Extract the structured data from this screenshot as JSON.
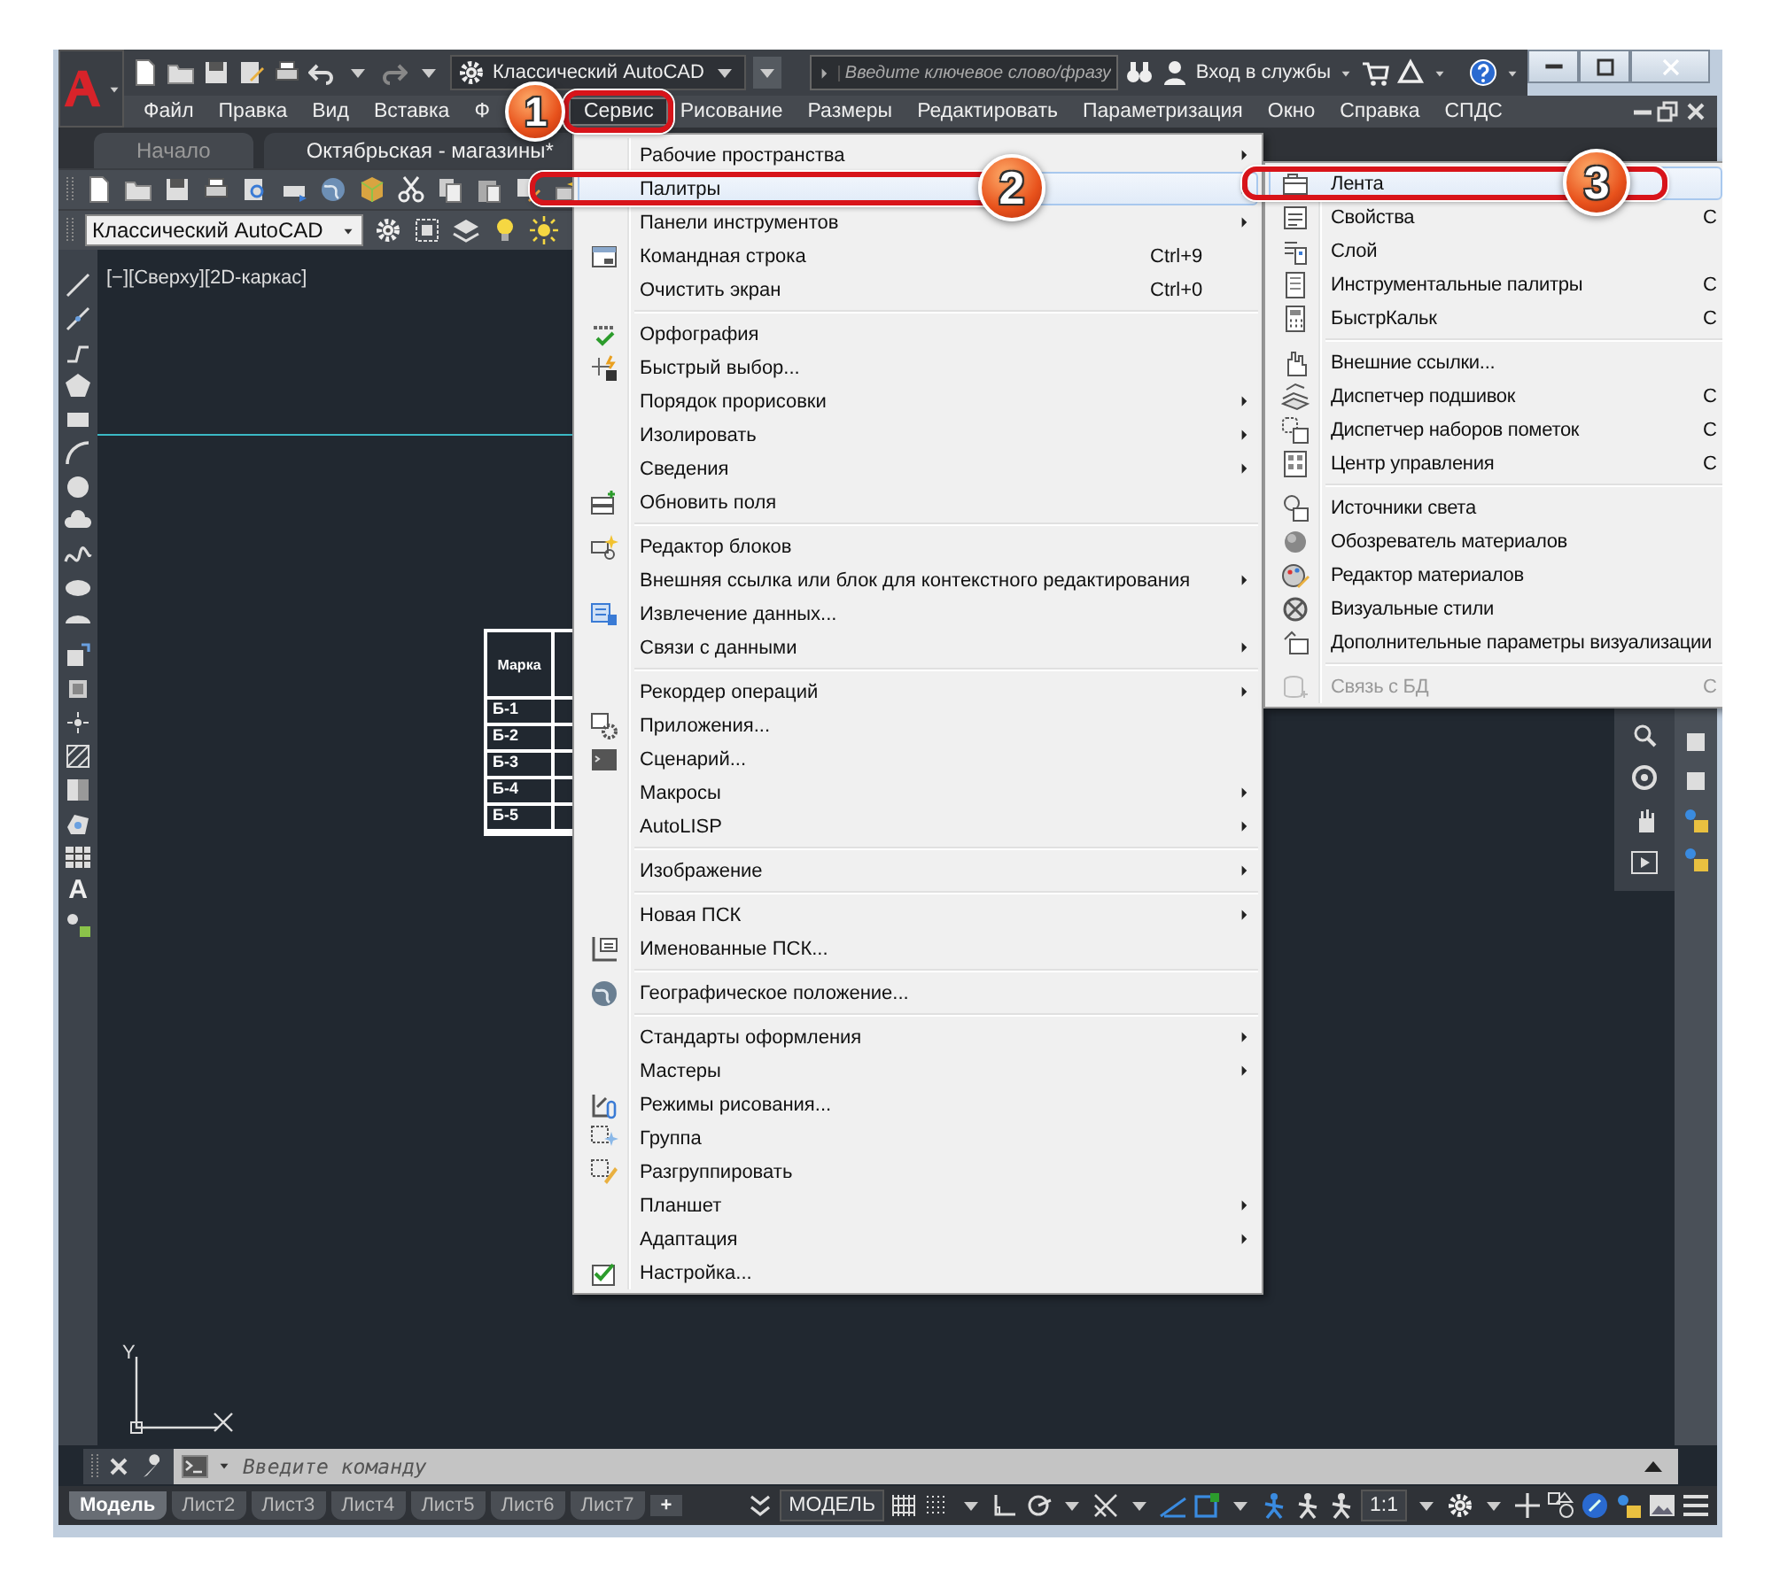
{
  "title_bar": {
    "workspace": "Классический AutoCAD",
    "search_placeholder": "Введите ключевое слово/фразу",
    "sign_in": "Вход в службы"
  },
  "menu_bar": [
    {
      "label": "Файл",
      "selected": false
    },
    {
      "label": "Правка",
      "selected": false
    },
    {
      "label": "Вид",
      "selected": false
    },
    {
      "label": "Вставка",
      "selected": false
    },
    {
      "label": "Ф",
      "selected": false
    },
    {
      "label": "Сервис",
      "selected": true
    },
    {
      "label": "Рисование",
      "selected": false
    },
    {
      "label": "Размеры",
      "selected": false
    },
    {
      "label": "Редактировать",
      "selected": false
    },
    {
      "label": "Параметризация",
      "selected": false
    },
    {
      "label": "Окно",
      "selected": false
    },
    {
      "label": "Справка",
      "selected": false
    },
    {
      "label": "СПДС",
      "selected": false
    }
  ],
  "doc_tabs": [
    {
      "label": "Начало",
      "selected": false
    },
    {
      "label": "Октябрьская - магазины*",
      "selected": true
    }
  ],
  "workspace_dropdown": "Классический AutoCAD",
  "viewport_label": "[−][Сверху][2D-каркас]",
  "text_tool_label": "A",
  "drawing_table": {
    "header": "Марка",
    "rows": [
      "Б-1",
      "Б-2",
      "Б-3",
      "Б-4",
      "Б-5"
    ]
  },
  "ucs_axis_label": "Y",
  "service_menu": [
    {
      "kind": "item",
      "label": "Рабочие пространства",
      "submenu": true,
      "selected": false
    },
    {
      "kind": "item",
      "label": "Палитры",
      "submenu": true,
      "selected": true
    },
    {
      "kind": "item",
      "label": "Панели инструментов",
      "submenu": true,
      "selected": false
    },
    {
      "kind": "item",
      "label": "Командная строка",
      "shortcut": "Ctrl+9",
      "icon": true,
      "selected": false
    },
    {
      "kind": "item",
      "label": "Очистить экран",
      "shortcut": "Ctrl+0",
      "selected": false
    },
    {
      "kind": "separator"
    },
    {
      "kind": "item",
      "label": "Орфография",
      "icon": true,
      "selected": false
    },
    {
      "kind": "item",
      "label": "Быстрый выбор...",
      "icon": true,
      "selected": false
    },
    {
      "kind": "item",
      "label": "Порядок прорисовки",
      "submenu": true,
      "selected": false
    },
    {
      "kind": "item",
      "label": "Изолировать",
      "submenu": true,
      "selected": false
    },
    {
      "kind": "item",
      "label": "Сведения",
      "submenu": true,
      "selected": false
    },
    {
      "kind": "item",
      "label": "Обновить поля",
      "icon": true,
      "selected": false
    },
    {
      "kind": "separator"
    },
    {
      "kind": "item",
      "label": "Редактор блоков",
      "icon": true,
      "selected": false
    },
    {
      "kind": "item",
      "label": "Внешняя ссылка или блок для контекстного редактирования",
      "submenu": true,
      "selected": false
    },
    {
      "kind": "item",
      "label": "Извлечение данных...",
      "icon": true,
      "selected": false
    },
    {
      "kind": "item",
      "label": "Связи с данными",
      "submenu": true,
      "selected": false
    },
    {
      "kind": "separator"
    },
    {
      "kind": "item",
      "label": "Рекордер операций",
      "submenu": true,
      "selected": false
    },
    {
      "kind": "item",
      "label": "Приложения...",
      "icon": true,
      "selected": false
    },
    {
      "kind": "item",
      "label": "Сценарий...",
      "icon": true,
      "selected": false
    },
    {
      "kind": "item",
      "label": "Макросы",
      "submenu": true,
      "selected": false
    },
    {
      "kind": "item",
      "label": "AutoLISP",
      "submenu": true,
      "selected": false
    },
    {
      "kind": "separator"
    },
    {
      "kind": "item",
      "label": "Изображение",
      "submenu": true,
      "selected": false
    },
    {
      "kind": "separator"
    },
    {
      "kind": "item",
      "label": "Новая ПСК",
      "submenu": true,
      "selected": false
    },
    {
      "kind": "item",
      "label": "Именованные ПСК...",
      "icon": true,
      "selected": false
    },
    {
      "kind": "separator"
    },
    {
      "kind": "item",
      "label": "Географическое положение...",
      "icon": true,
      "selected": false
    },
    {
      "kind": "separator"
    },
    {
      "kind": "item",
      "label": "Стандарты оформления",
      "submenu": true,
      "selected": false
    },
    {
      "kind": "item",
      "label": "Мастеры",
      "submenu": true,
      "selected": false
    },
    {
      "kind": "item",
      "label": "Режимы рисования...",
      "icon": true,
      "selected": false
    },
    {
      "kind": "item",
      "label": "Группа",
      "icon": true,
      "selected": false
    },
    {
      "kind": "item",
      "label": "Разгруппировать",
      "icon": true,
      "selected": false
    },
    {
      "kind": "item",
      "label": "Планшет",
      "submenu": true,
      "selected": false
    },
    {
      "kind": "item",
      "label": "Адаптация",
      "submenu": true,
      "selected": false
    },
    {
      "kind": "item",
      "label": "Настройка...",
      "icon": true,
      "selected": false
    }
  ],
  "palettes_submenu": [
    {
      "kind": "item",
      "label": "Лента",
      "selected": true,
      "disabled": false
    },
    {
      "kind": "item",
      "label": "Свойства",
      "shortcut": "C",
      "selected": false,
      "disabled": false
    },
    {
      "kind": "item",
      "label": "Слой",
      "selected": false,
      "disabled": false
    },
    {
      "kind": "item",
      "label": "Инструментальные палитры",
      "shortcut": "C",
      "selected": false,
      "disabled": false
    },
    {
      "kind": "item",
      "label": "БыстрКальк",
      "shortcut": "C",
      "selected": false,
      "disabled": false
    },
    {
      "kind": "separator"
    },
    {
      "kind": "item",
      "label": "Внешние ссылки...",
      "selected": false,
      "disabled": false
    },
    {
      "kind": "item",
      "label": "Диспетчер подшивок",
      "shortcut": "C",
      "selected": false,
      "disabled": false
    },
    {
      "kind": "item",
      "label": "Диспетчер наборов пометок",
      "shortcut": "C",
      "selected": false,
      "disabled": false
    },
    {
      "kind": "item",
      "label": "Центр управления",
      "shortcut": "C",
      "selected": false,
      "disabled": false
    },
    {
      "kind": "separator"
    },
    {
      "kind": "item",
      "label": "Источники света",
      "selected": false,
      "disabled": false
    },
    {
      "kind": "item",
      "label": "Обозреватель материалов",
      "selected": false,
      "disabled": false
    },
    {
      "kind": "item",
      "label": "Редактор материалов",
      "selected": false,
      "disabled": false
    },
    {
      "kind": "item",
      "label": "Визуальные стили",
      "selected": false,
      "disabled": false
    },
    {
      "kind": "item",
      "label": "Дополнительные параметры визуализации",
      "selected": false,
      "disabled": false
    },
    {
      "kind": "separator"
    },
    {
      "kind": "item",
      "label": "Связь с БД",
      "shortcut": "C",
      "selected": false,
      "disabled": true
    }
  ],
  "callouts": [
    {
      "number": "1"
    },
    {
      "number": "2"
    },
    {
      "number": "3"
    }
  ],
  "command_line": {
    "placeholder": "Введите команду"
  },
  "layout_tabs": [
    {
      "label": "Модель",
      "selected": true
    },
    {
      "label": "Лист2",
      "selected": false
    },
    {
      "label": "Лист3",
      "selected": false
    },
    {
      "label": "Лист4",
      "selected": false
    },
    {
      "label": "Лист5",
      "selected": false
    },
    {
      "label": "Лист6",
      "selected": false
    },
    {
      "label": "Лист7",
      "selected": false
    }
  ],
  "add_tab": "+",
  "status_bar": {
    "model": "МОДЕЛЬ",
    "scale": "1:1"
  }
}
